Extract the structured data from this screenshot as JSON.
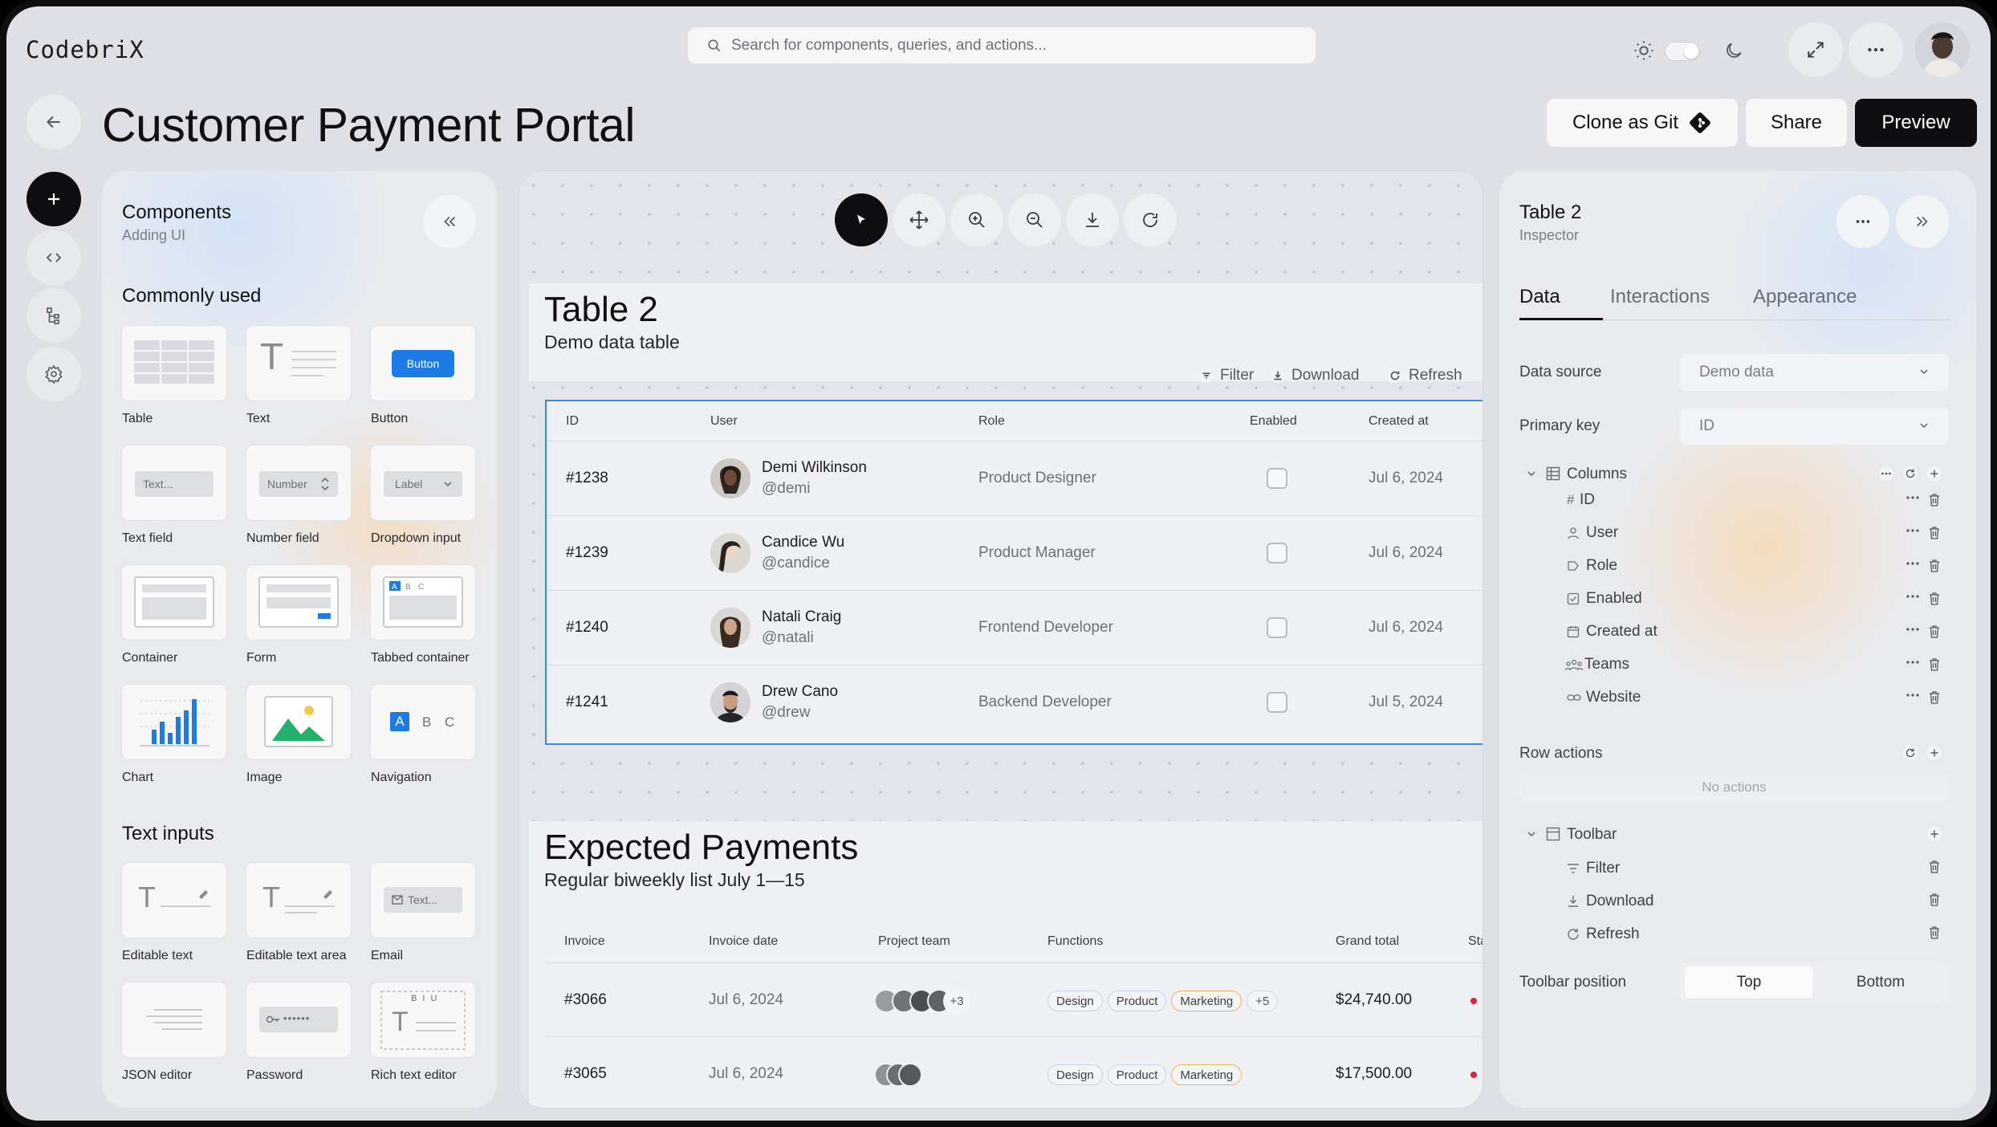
{
  "app": {
    "logo": "CodebriX"
  },
  "search": {
    "placeholder": "Search for components, queries, and actions..."
  },
  "header": {
    "sun_icon": "sun-icon",
    "moon_icon": "moon-icon",
    "expand_icon": "expand-icon",
    "more_icon": "more-icon"
  },
  "page": {
    "title": "Customer Payment Portal",
    "clone_label": "Clone as Git",
    "share_label": "Share",
    "preview_label": "Preview"
  },
  "components": {
    "title": "Components",
    "subtitle": "Adding UI",
    "common_heading": "Commonly used",
    "common": [
      {
        "label": "Table"
      },
      {
        "label": "Text"
      },
      {
        "label": "Button",
        "preview": "Button"
      },
      {
        "label": "Text field",
        "preview": "Text..."
      },
      {
        "label": "Number field",
        "preview": "Number"
      },
      {
        "label": "Dropdown input",
        "preview": "Label"
      },
      {
        "label": "Container"
      },
      {
        "label": "Form"
      },
      {
        "label": "Tabbed container"
      },
      {
        "label": "Chart"
      },
      {
        "label": "Image"
      },
      {
        "label": "Navigation"
      }
    ],
    "text_heading": "Text inputs",
    "text_inputs": [
      {
        "label": "Editable text"
      },
      {
        "label": "Editable text area"
      },
      {
        "label": "Email",
        "preview": "Text..."
      },
      {
        "label": "JSON editor"
      },
      {
        "label": "Password",
        "preview": "••••••"
      },
      {
        "label": "Rich text editor"
      }
    ],
    "tab_letters": [
      "A",
      "B",
      "C"
    ],
    "rte_toolbar": "B I U",
    "text_glyph": "T"
  },
  "table2": {
    "title": "Table 2",
    "subtitle": "Demo data table",
    "toolbar": {
      "filter": "Filter",
      "download": "Download",
      "refresh": "Refresh"
    },
    "columns": [
      "ID",
      "User",
      "Role",
      "Enabled",
      "Created at"
    ],
    "rows": [
      {
        "id": "#1238",
        "name": "Demi Wilkinson",
        "handle": "@demi",
        "role": "Product Designer",
        "enabled": false,
        "created": "Jul 6, 2024"
      },
      {
        "id": "#1239",
        "name": "Candice Wu",
        "handle": "@candice",
        "role": "Product Manager",
        "enabled": false,
        "created": "Jul 6, 2024"
      },
      {
        "id": "#1240",
        "name": "Natali Craig",
        "handle": "@natali",
        "role": "Frontend Developer",
        "enabled": false,
        "created": "Jul 6, 2024"
      },
      {
        "id": "#1241",
        "name": "Drew Cano",
        "handle": "@drew",
        "role": "Backend Developer",
        "enabled": false,
        "created": "Jul 5, 2024"
      }
    ]
  },
  "payments": {
    "title": "Expected Payments",
    "subtitle": "Regular biweekly list July 1—15",
    "columns": [
      "Invoice",
      "Invoice date",
      "Project team",
      "Functions",
      "Grand total",
      "Sta"
    ],
    "rows": [
      {
        "invoice": "#3066",
        "date": "Jul 6, 2024",
        "team_extra": "+3",
        "tags": [
          "Design",
          "Product",
          "Marketing"
        ],
        "tags_extra": "+5",
        "total": "$24,740.00"
      },
      {
        "invoice": "#3065",
        "date": "Jul 6, 2024",
        "team_extra": "",
        "tags": [
          "Design",
          "Product",
          "Marketing"
        ],
        "tags_extra": "",
        "total": "$17,500.00"
      }
    ]
  },
  "inspector": {
    "title": "Table 2",
    "subtitle": "Inspector",
    "tabs": [
      "Data",
      "Interactions",
      "Appearance"
    ],
    "data_source_label": "Data source",
    "data_source_value": "Demo data",
    "primary_key_label": "Primary key",
    "primary_key_value": "ID",
    "columns_label": "Columns",
    "columns": [
      "ID",
      "User",
      "Role",
      "Enabled",
      "Created at",
      "Teams",
      "Website"
    ],
    "row_actions_label": "Row actions",
    "no_actions": "No actions",
    "toolbar_label": "Toolbar",
    "toolbar_items": [
      "Filter",
      "Download",
      "Refresh"
    ],
    "toolbar_position_label": "Toolbar position",
    "position_options": [
      "Top",
      "Bottom"
    ],
    "position_selected": "Top"
  },
  "colors": {
    "accent": "#1e7be6",
    "dark": "#0e0e10",
    "marketing_border": "#f0b45a",
    "tag_border": "#bfd5ee"
  }
}
